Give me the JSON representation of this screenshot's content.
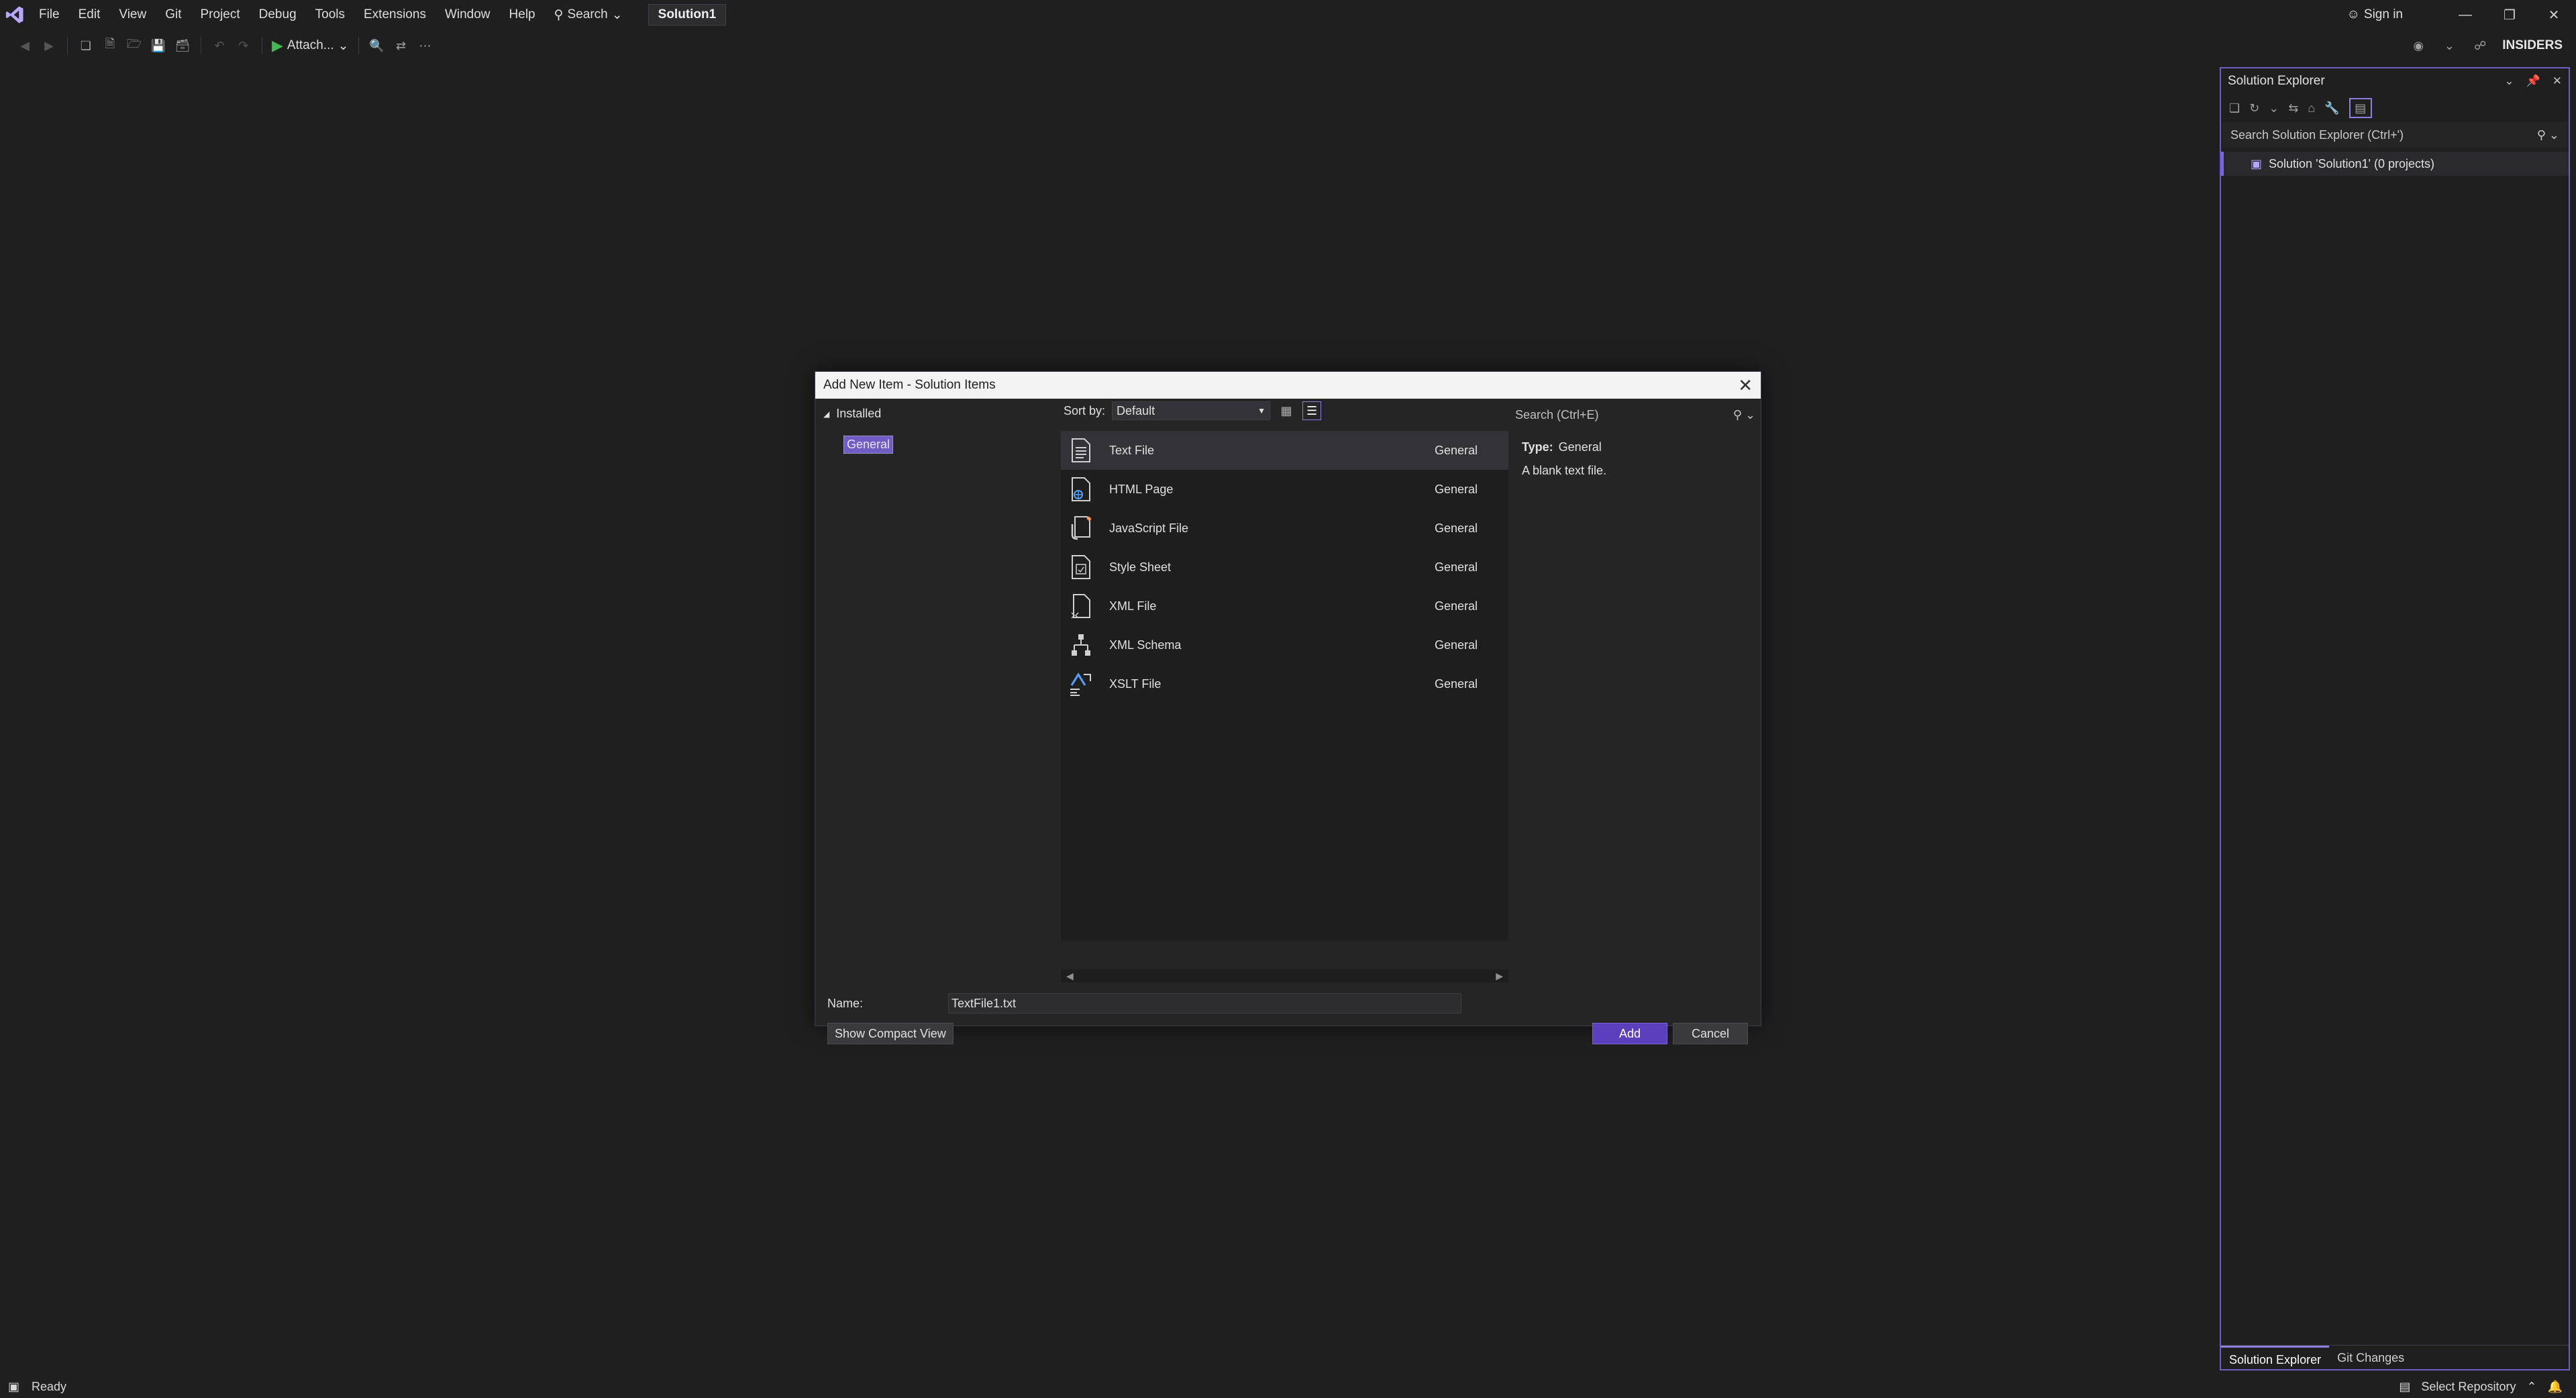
{
  "menubar": {
    "items": [
      "File",
      "Edit",
      "View",
      "Git",
      "Project",
      "Debug",
      "Tools",
      "Extensions",
      "Window",
      "Help"
    ],
    "search_label": "Search",
    "solution_name": "Solution1",
    "signin_label": "Sign in"
  },
  "toolbar": {
    "attach_label": "Attach...",
    "insiders_label": "INSIDERS"
  },
  "solution_explorer": {
    "title": "Solution Explorer",
    "search_placeholder": "Search Solution Explorer (Ctrl+')",
    "tree_root": "Solution 'Solution1' (0 projects)",
    "tabs": [
      "Solution Explorer",
      "Git Changes"
    ]
  },
  "statusbar": {
    "status": "Ready",
    "repo_label": "Select Repository"
  },
  "dialog": {
    "title": "Add New Item - Solution Items",
    "installed_label": "Installed",
    "category": "General",
    "sort_label": "Sort by:",
    "sort_value": "Default",
    "search_placeholder": "Search (Ctrl+E)",
    "items": [
      {
        "name": "Text File",
        "category": "General",
        "icon": "text-file-icon"
      },
      {
        "name": "HTML Page",
        "category": "General",
        "icon": "html-page-icon"
      },
      {
        "name": "JavaScript File",
        "category": "General",
        "icon": "javascript-file-icon"
      },
      {
        "name": "Style Sheet",
        "category": "General",
        "icon": "style-sheet-icon"
      },
      {
        "name": "XML File",
        "category": "General",
        "icon": "xml-file-icon"
      },
      {
        "name": "XML Schema",
        "category": "General",
        "icon": "xml-schema-icon"
      },
      {
        "name": "XSLT File",
        "category": "General",
        "icon": "xslt-file-icon"
      }
    ],
    "selected_index": 0,
    "type_label": "Type:",
    "type_value": "General",
    "description": "A blank text file.",
    "name_label": "Name:",
    "name_value": "TextFile1.txt",
    "compact_view_label": "Show Compact View",
    "add_label": "Add",
    "cancel_label": "Cancel"
  },
  "colors": {
    "accent": "#6f5cc4",
    "add_button": "#5b3fbd",
    "background": "#1f1f1f"
  }
}
